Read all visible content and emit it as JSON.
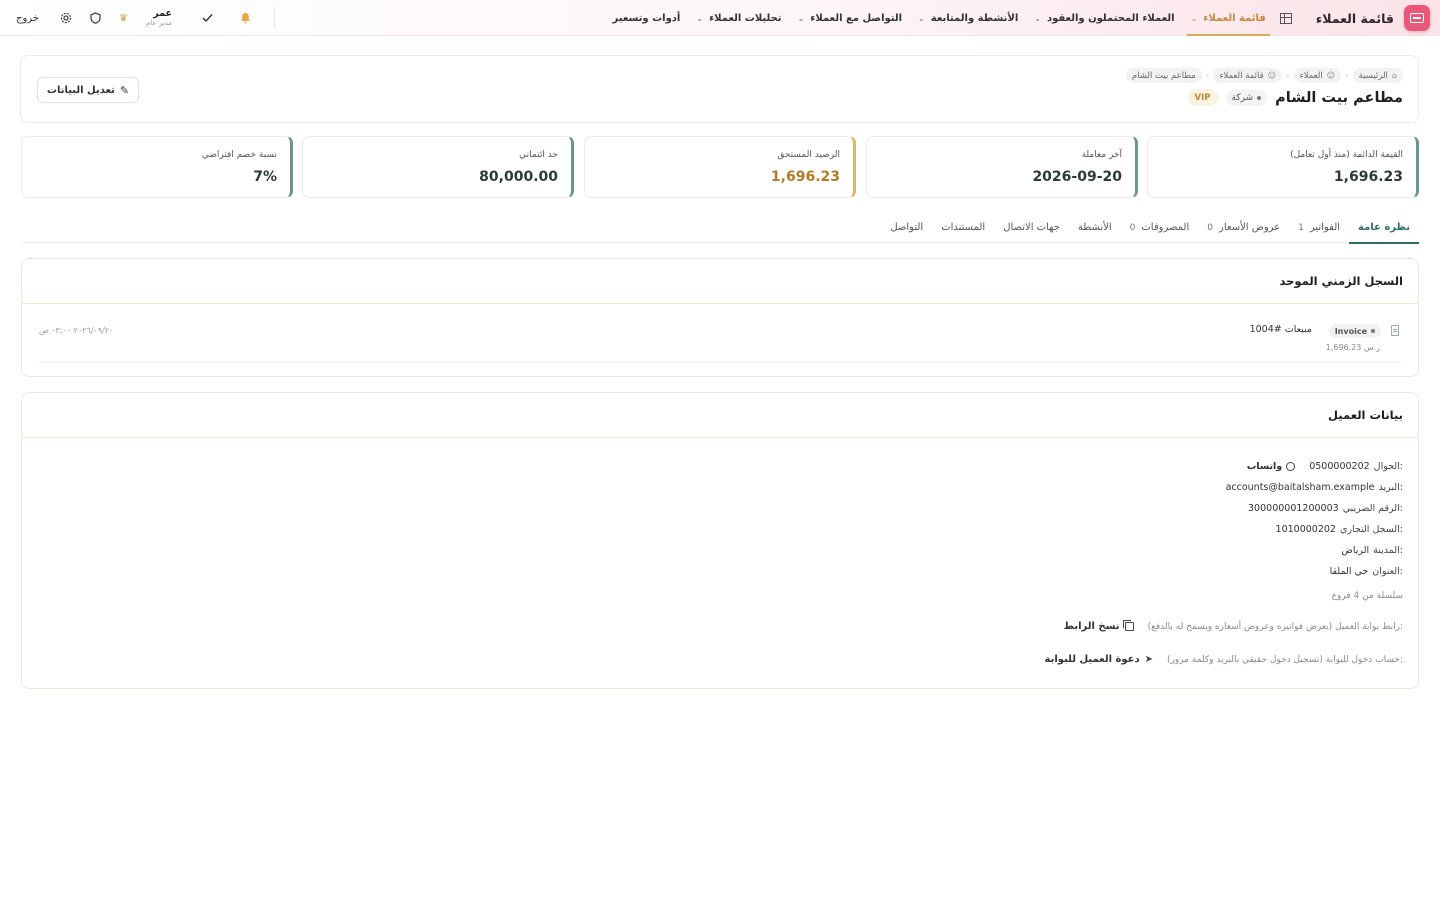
{
  "topbar": {
    "app_title": "قائمة العملاء",
    "nav": [
      {
        "label": "قائمة العملاء",
        "active": true
      },
      {
        "label": "العملاء المحتملون والعقود",
        "active": false
      },
      {
        "label": "الأنشطة والمتابعة",
        "active": false
      },
      {
        "label": "التواصل مع العملاء",
        "active": false
      },
      {
        "label": "تحليلات العملاء",
        "active": false
      },
      {
        "label": "أدوات وتسعير",
        "active": false
      }
    ],
    "user_name": "عمر",
    "user_role": "مدير عام",
    "logout": "خروج",
    "icons": [
      "bell-icon",
      "check-icon",
      "crown-icon",
      "shield-icon",
      "gear-icon"
    ]
  },
  "breadcrumb": [
    {
      "label": "الرئيسية",
      "icon": "home-icon"
    },
    {
      "label": "العملاء",
      "icon": "users-icon"
    },
    {
      "label": "قائمة العملاء",
      "icon": "user-list-icon"
    },
    {
      "label": "مطاعم بيت الشام",
      "icon": ""
    }
  ],
  "customer": {
    "name": "مطاعم بيت الشام",
    "type": "شركة",
    "badge": "VIP",
    "edit_label": "تعديل البيانات"
  },
  "stats": [
    {
      "label": "القيمة الدائمة (منذ أول تعامل)",
      "value": "1,696.23",
      "accent": "#6a9694"
    },
    {
      "label": "آخر معاملة",
      "value": "2026-09-20",
      "accent": "#6a9694"
    },
    {
      "label": "الرصيد المستحق",
      "value": "1,696.23",
      "accent": "#e3b461"
    },
    {
      "label": "حد ائتماني",
      "value": "80,000.00",
      "accent": "#6a9694"
    },
    {
      "label": "نسبة خصم افتراضي",
      "value": "7%",
      "accent": "#6a9694"
    }
  ],
  "tabs": [
    {
      "label": "نظرة عامة",
      "count": "",
      "active": true
    },
    {
      "label": "الفواتير",
      "count": "1",
      "active": false
    },
    {
      "label": "عروض الأسعار",
      "count": "0",
      "active": false
    },
    {
      "label": "المصروفات",
      "count": "0",
      "active": false
    },
    {
      "label": "الأنشطة",
      "count": "",
      "active": false
    },
    {
      "label": "جهات الاتصال",
      "count": "",
      "active": false
    },
    {
      "label": "المستندات",
      "count": "",
      "active": false
    },
    {
      "label": "التواصل",
      "count": "",
      "active": false
    }
  ],
  "timeline": {
    "title": "السجل الزمني الموحد",
    "items": [
      {
        "type": "Invoice",
        "title": "مبيعات #1004",
        "amount": "1,696.23 ر.س",
        "date": "٢٠٢٦/٠٩/٢٠ ٠٣:٠٠ ص"
      }
    ]
  },
  "details": {
    "title": "بيانات العميل",
    "mobile_label": "الجوال:",
    "mobile": "0500000202",
    "whatsapp": "واتساب",
    "email_label": "البريد:",
    "email": "accounts@baitalsham.example",
    "tax_label": "الرقم الضريبي:",
    "tax": "300000001200003",
    "cr_label": "السجل التجاري:",
    "cr": "1010000202",
    "city_label": "المدينة:",
    "city": "الرياض",
    "address_label": "العنوان:",
    "address": "حي الملقا",
    "chain_note": "سلسلة من 4 فروع",
    "portal_link_note": "رابط بوابة العميل (يعرض فواتيره وعروض أسعاره ويسمح له بالدفع):",
    "copy_link": "نسخ الرابط",
    "portal_account_note": "حساب دخول للبوابة (تسجيل دخول حقيقي بالبريد وكلمة مرور):",
    "invite": "دعوة العميل للبوابة"
  }
}
